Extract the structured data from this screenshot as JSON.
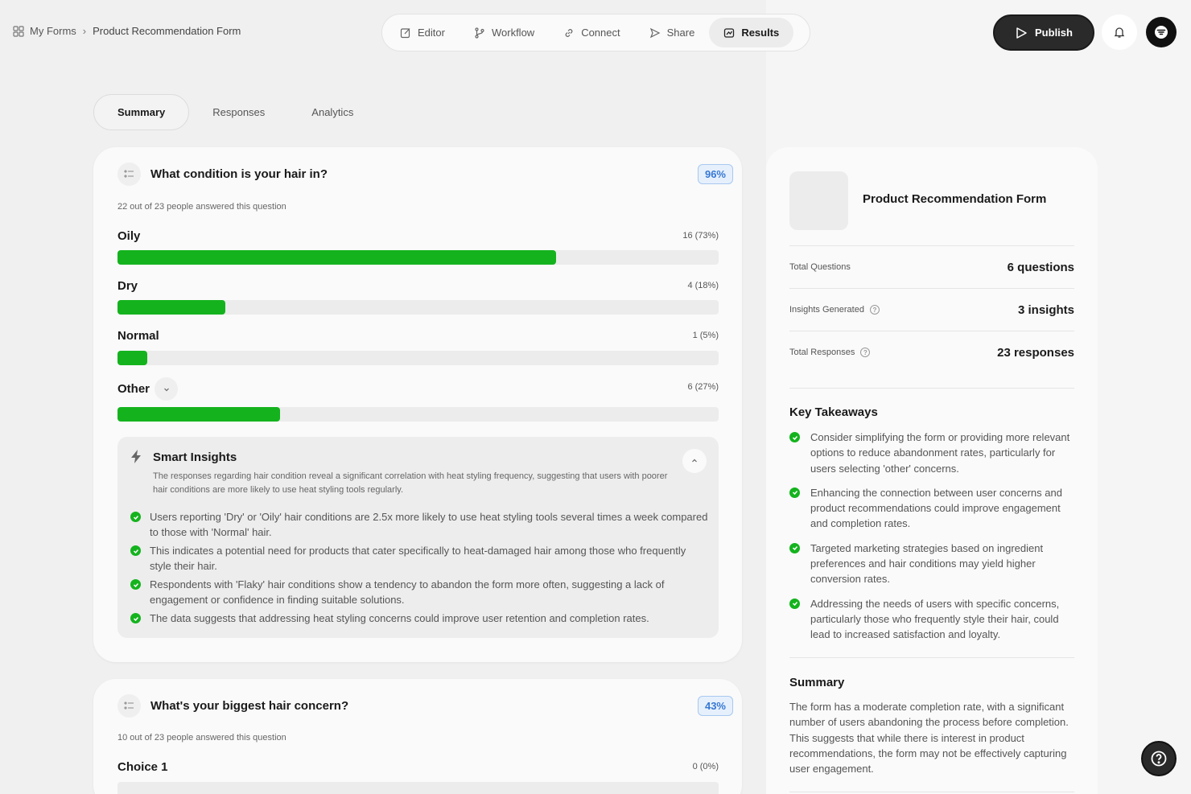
{
  "breadcrumb": {
    "root": "My Forms",
    "current": "Product Recommendation Form"
  },
  "nav": {
    "editor": "Editor",
    "workflow": "Workflow",
    "connect": "Connect",
    "share": "Share",
    "results": "Results"
  },
  "header": {
    "publish_label": "Publish"
  },
  "tabs": {
    "summary": "Summary",
    "responses": "Responses",
    "analytics": "Analytics"
  },
  "question1": {
    "title": "What condition is your hair in?",
    "percent": "96%",
    "answered": "22 out of 23 people answered this question",
    "options": [
      {
        "label": "Oily",
        "count": "16 (73%)",
        "fill": 0.73
      },
      {
        "label": "Dry",
        "count": "4 (18%)",
        "fill": 0.18
      },
      {
        "label": "Normal",
        "count": "1 (5%)",
        "fill": 0.05
      },
      {
        "label": "Other",
        "count": "6 (27%)",
        "fill": 0.27
      }
    ],
    "insights": {
      "title": "Smart Insights",
      "description": "The responses regarding hair condition reveal a significant correlation with heat styling frequency, suggesting that users with poorer hair conditions are more likely to use heat styling tools regularly.",
      "items": [
        "Users reporting 'Dry' or 'Oily' hair conditions are 2.5x more likely to use heat styling tools several times a week compared to those with 'Normal' hair.",
        "This indicates a potential need for products that cater specifically to heat-damaged hair among those who frequently style their hair.",
        "Respondents with 'Flaky' hair conditions show a tendency to abandon the form more often, suggesting a lack of engagement or confidence in finding suitable solutions.",
        "The data suggests that addressing heat styling concerns could improve user retention and completion rates."
      ]
    }
  },
  "question2": {
    "title": "What's your biggest hair concern?",
    "percent": "43%",
    "answered": "10 out of 23 people answered this question",
    "options": [
      {
        "label": "Choice 1",
        "count": "0 (0%)",
        "fill": 0
      }
    ]
  },
  "side": {
    "title": "Product Recommendation Form",
    "stats": [
      {
        "label": "Total Questions",
        "value": "6 questions"
      },
      {
        "label": "Insights Generated",
        "value": "3 insights"
      },
      {
        "label": "Total Responses",
        "value": "23 responses"
      }
    ],
    "takeaways_title": "Key Takeaways",
    "takeaways": [
      "Consider simplifying the form or providing more relevant options to reduce abandonment rates, particularly for users selecting 'other' concerns.",
      "Enhancing the connection between user concerns and product recommendations could improve engagement and completion rates.",
      "Targeted marketing strategies based on ingredient preferences and hair conditions may yield higher conversion rates.",
      "Addressing the needs of users with specific concerns, particularly those who frequently style their hair, could lead to increased satisfaction and loyalty."
    ],
    "summary_title": "Summary",
    "summary_text": "The form has a moderate completion rate, with a significant number of users abandoning the process before completion. This suggests that while there is interest in product recommendations, the form may not be effectively capturing user engagement."
  },
  "colors": {
    "bar": "#14b31e",
    "percent_badge": "#3778d4",
    "dark": "#2a2a2a"
  }
}
